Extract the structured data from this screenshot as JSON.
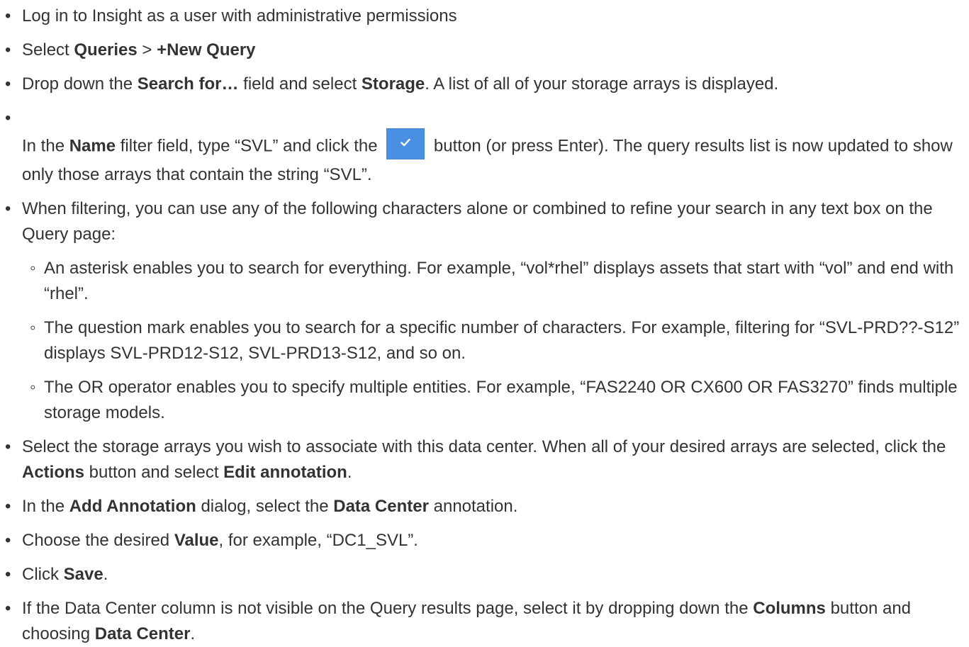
{
  "steps": [
    {
      "t1": "Log in to Insight as a user with administrative permissions"
    },
    {
      "t1": "Select ",
      "b1": "Queries",
      "t2": " > ",
      "b2": "+New Query"
    },
    {
      "t1": "Drop down the ",
      "b1": "Search for…",
      "t2": " field and select ",
      "b2": "Storage",
      "t3": ". A list of all of your storage arrays is displayed."
    },
    {
      "t1": "In the ",
      "b1": "Name",
      "t2": " filter field, type “SVL” and click the ",
      "button_icon": "check-icon",
      "t3": " button (or press Enter). The query results list is now updated to show only those arrays that contain the string “SVL”."
    },
    {
      "t1": "When filtering, you can use any of the following characters alone or combined to refine your search in any text box on the Query page:",
      "sub": [
        "An asterisk enables you to search for everything. For example, “vol*rhel” displays assets that start with “vol” and end with “rhel”.",
        "The question mark enables you to search for a specific number of characters. For example, filtering for “SVL-PRD??-S12” displays SVL-PRD12-S12, SVL-PRD13-S12, and so on.",
        "The OR operator enables you to specify multiple entities. For example, “FAS2240 OR CX600 OR FAS3270” finds multiple storage models."
      ]
    },
    {
      "t1": "Select the storage arrays you wish to associate with this data center. When all of your desired arrays are selected, click the ",
      "b1": "Actions",
      "t2": " button and select ",
      "b2": "Edit annotation",
      "t3": "."
    },
    {
      "t1": "In the ",
      "b1": "Add Annotation",
      "t2": " dialog, select the ",
      "b2": "Data Center",
      "t3": " annotation."
    },
    {
      "t1": "Choose the desired ",
      "b1": "Value",
      "t2": ", for example, “DC1_SVL”."
    },
    {
      "t1": "Click ",
      "b1": "Save",
      "t2": "."
    },
    {
      "t1": "If the Data Center column is not visible on the Query results page, select it by dropping down the ",
      "b1": "Columns",
      "t2": " button and choosing ",
      "b2": "Data Center",
      "t3": "."
    }
  ],
  "colors": {
    "text": "#333333",
    "button_blue": "#4a90e2"
  }
}
